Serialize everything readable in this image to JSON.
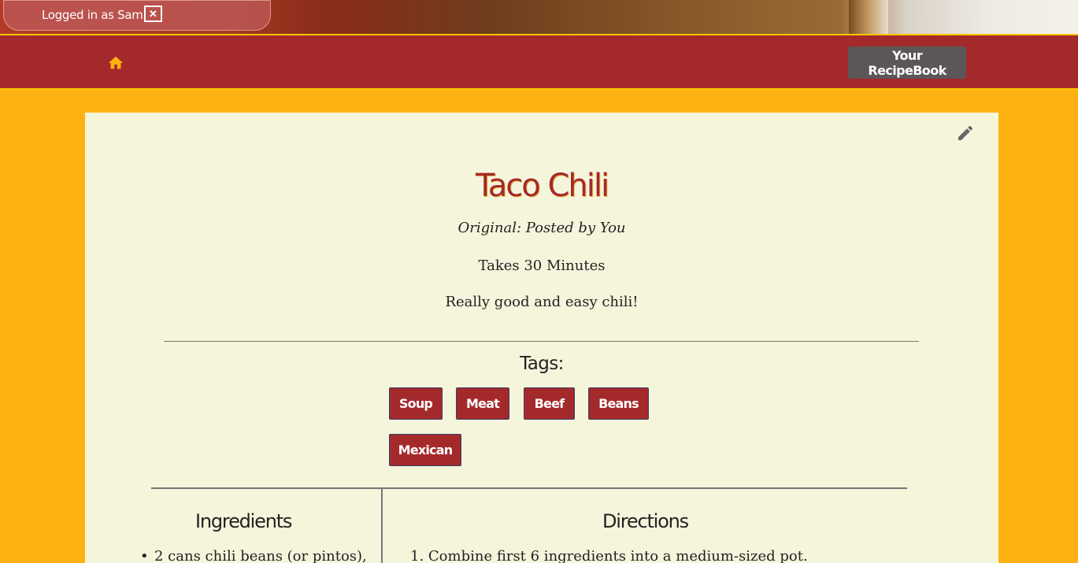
{
  "banner": {
    "login_text": "Logged in as Sam",
    "close_icon": "close-box-icon"
  },
  "navbar": {
    "home_icon": "home-icon",
    "recipebook_label": "Your RecipeBook",
    "colors": {
      "bar": "#a4292b",
      "accent": "#f7c600",
      "button": "#5c5658"
    }
  },
  "recipe": {
    "title": "Taco Chili",
    "origin": "Original: Posted by You",
    "time": "Takes 30 Minutes",
    "description": "Really good and easy chili!",
    "tags_heading": "Tags:",
    "tags": [
      "Soup",
      "Meat",
      "Beef",
      "Beans",
      "Mexican"
    ],
    "ingredients_heading": "Ingredients",
    "ingredients": [
      "2 cans chili beans (or pintos),"
    ],
    "directions_heading": "Directions",
    "directions": [
      "Combine first 6 ingredients into a medium-sized pot."
    ]
  },
  "page": {
    "background": "#fdb212",
    "card": "#f5f5dc"
  }
}
